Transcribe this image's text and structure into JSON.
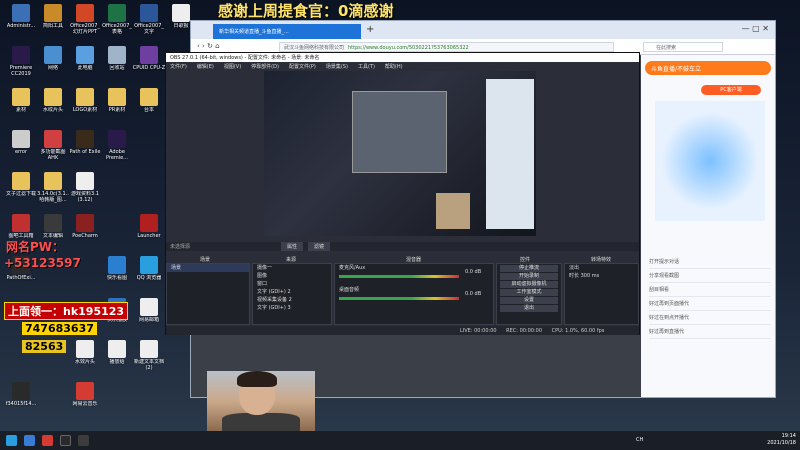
{
  "overlay": {
    "title": "感谢上周提食官：0滴感谢",
    "qq_label": "网名PW：",
    "phone": "+53123597",
    "promo_code": "上面领一：hk195123",
    "badge_number": "747683637",
    "badge2": "82563"
  },
  "desktop_icons": [
    {
      "label": "Administr...",
      "color": "#3b6fb6"
    },
    {
      "label": "简阳工具",
      "color": "#c98a2a"
    },
    {
      "label": "Office2007_ 幻灯片PPT",
      "color": "#d24726"
    },
    {
      "label": "Office2007_ 表格",
      "color": "#1f7244"
    },
    {
      "label": "Office2007_ 文字",
      "color": "#2b579a"
    },
    {
      "label": "日歌报",
      "color": "#eeeeee"
    },
    {
      "label": "Premiere CC2019",
      "color": "#2a1a4a"
    },
    {
      "label": "网络",
      "color": "#4a90d0"
    },
    {
      "label": "此电脑",
      "color": "#5aa0e0"
    },
    {
      "label": "回收站",
      "color": "#9fb4c8"
    },
    {
      "label": "CPUID CPU-Z",
      "color": "#6e3fa0"
    },
    {
      "label": "素材",
      "color": "#e8c25a"
    },
    {
      "label": "水纹片头",
      "color": "#e8c25a"
    },
    {
      "label": "LOGO素材",
      "color": "#e8c25a"
    },
    {
      "label": "PR素材",
      "color": "#e8c25a"
    },
    {
      "label": "台本",
      "color": "#e8c25a"
    },
    {
      "label": "error",
      "color": "#cccccc"
    },
    {
      "label": "多功能截图 AHK",
      "color": "#d04040"
    },
    {
      "label": "Path of Exile",
      "color": "#3a2a1a"
    },
    {
      "label": "Adobe Premie...",
      "color": "#2a1a4a"
    },
    {
      "label": "文子过滤下载",
      "color": "#e8c25a"
    },
    {
      "label": "3.14.0c(3.1.. 哈韩版_图...",
      "color": "#e8c25a"
    },
    {
      "label": "游戏资料3.1 (3.12)",
      "color": "#eeeeee"
    },
    {
      "label": "图吧工具箱",
      "color": "#c03030"
    },
    {
      "label": "文本编辑",
      "color": "#3a3a3a"
    },
    {
      "label": "PoeCharm",
      "color": "#8a2020"
    },
    {
      "label": "Launcher",
      "color": "#b02020"
    },
    {
      "label": "PathOfExi...",
      "color": "#2a2a2a"
    },
    {
      "label": "快乐看图",
      "color": "#2a7fd0"
    },
    {
      "label": "QQ 浏览器",
      "color": "#2a9fe0"
    },
    {
      "label": "快乐播放",
      "color": "#3070c0"
    },
    {
      "label": "网易邮箱",
      "color": "#eeeeee"
    },
    {
      "label": "新建文本文档 (2)",
      "color": "#eeeeee"
    },
    {
      "label": "水效片头",
      "color": "#eeeeee"
    },
    {
      "label": "播放给",
      "color": "#eeeeee"
    },
    {
      "label": "f34015f14...",
      "color": "#2a2a2a"
    },
    {
      "label": "网易云音乐",
      "color": "#d43c33"
    }
  ],
  "browser": {
    "tab_title": "新华相关频道直播_斗鱼直播_...",
    "site": "武汉斗鱼网络科技有限公司",
    "url": "https://www.douyu.com/5030221?53763065322",
    "search_placeholder": "在此搜索",
    "side_header": "斗鱼直播/不鼓车立",
    "side_btn": "PC客户端",
    "side_items": [
      "打开提示对话",
      "分享观看截图",
      "刮目相看",
      "好过再到页面播代",
      "好过在到点开播代",
      "好过再到直播代"
    ]
  },
  "obs": {
    "title": "OBS 27.0.1 (64-bit, windows) - 配置文件: 未命名 - 场景: 未命名",
    "menu": [
      "文件(F)",
      "编辑(E)",
      "视图(V)",
      "停靠部件(D)",
      "配置文件(P)",
      "场景集(S)",
      "工具(T)",
      "帮助(H)"
    ],
    "preview_hint": "未选择源",
    "scene_tabs": [
      "属性",
      "滤镜"
    ],
    "panels": {
      "scenes_title": "场景",
      "sources_title": "来源",
      "mixer_title": "混音器",
      "transitions_title": "转场特效",
      "controls_title": "控件"
    },
    "scenes": [
      "场景"
    ],
    "sources": [
      "摄像一",
      "图像",
      "窗口",
      "文字 (GDI+) 2",
      "视频采集设备 2",
      "文字 (GDI+) 3"
    ],
    "mixer": [
      {
        "name": "桌面音频",
        "db": "0.0 dB"
      },
      {
        "name": "麦克风/Aux",
        "db": "0.0 dB"
      }
    ],
    "controls": [
      "停止推流",
      "开始录制",
      "启动虚拟摄像机",
      "工作室模式",
      "设置",
      "退出"
    ],
    "transition": {
      "type": "淡出",
      "duration_label": "时长",
      "duration": "300 ms"
    },
    "status": {
      "live": "LIVE: 00:00:00",
      "rec": "REC: 00:00:00",
      "cpu": "CPU: 1.0%, 60.00 fps"
    }
  },
  "taskbar": {
    "time": "19:14",
    "date": "2021/10/18",
    "lang": "CH"
  }
}
